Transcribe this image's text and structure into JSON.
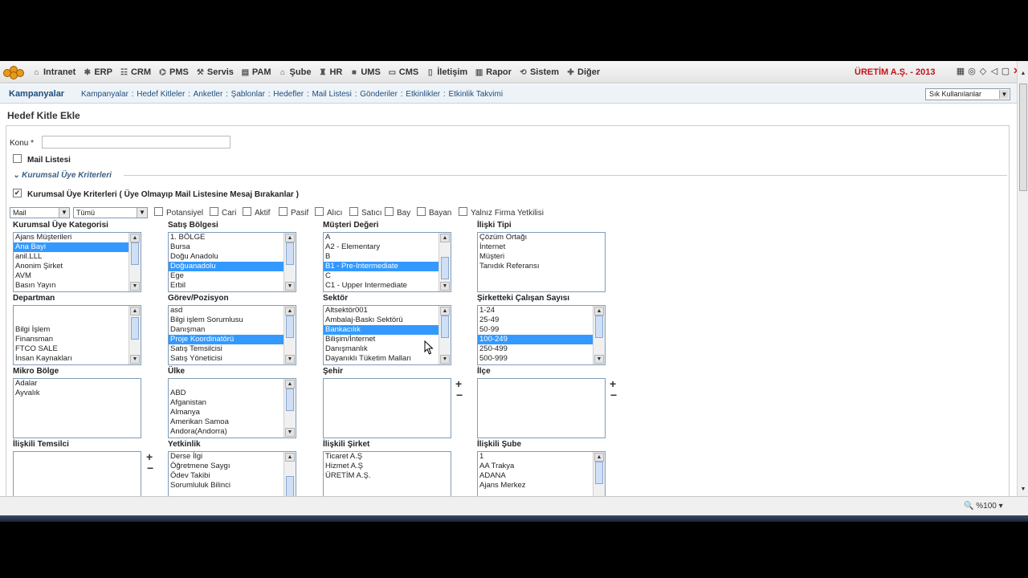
{
  "topbar": {
    "menu": [
      {
        "label": "Intranet",
        "icon": "folder-icon"
      },
      {
        "label": "ERP",
        "icon": "gear-icon"
      },
      {
        "label": "CRM",
        "icon": "crm-icon"
      },
      {
        "label": "PMS",
        "icon": "network-icon"
      },
      {
        "label": "Servis",
        "icon": "tools-icon"
      },
      {
        "label": "PAM",
        "icon": "printer-icon"
      },
      {
        "label": "Şube",
        "icon": "branch-icon"
      },
      {
        "label": "HR",
        "icon": "hr-icon"
      },
      {
        "label": "UMS",
        "icon": "ums-icon"
      },
      {
        "label": "CMS",
        "icon": "document-icon"
      },
      {
        "label": "İletişim",
        "icon": "contact-icon"
      },
      {
        "label": "Rapor",
        "icon": "chart-icon"
      },
      {
        "label": "Sistem",
        "icon": "refresh-icon"
      },
      {
        "label": "Diğer",
        "icon": "plus-icon"
      }
    ],
    "company": "ÜRETİM A.Ş. - 2013"
  },
  "subnav": {
    "title": "Kampanyalar",
    "links": [
      "Kampanyalar",
      "Hedef Kitleler",
      "Anketler",
      "Şablonlar",
      "Hedefler",
      "Mail Listesi",
      "Gönderiler",
      "Etkinlikler",
      "Etkinlik Takvimi"
    ],
    "separator": " : ",
    "favorites": "Sık Kullanılanlar"
  },
  "page": {
    "title": "Hedef Kitle Ekle",
    "konu_label": "Konu *",
    "mail_listesi": "Mail Listesi",
    "section": "Kurumsal Üye Kriterleri",
    "kriter_label": "Kurumsal Üye Kriterleri ( Üye Olmayıp Mail Listesine Mesaj Bırakanlar )"
  },
  "filters": {
    "select1": "Mail",
    "select2": "Tümü",
    "checks": [
      "Potansiyel",
      "Cari",
      "Aktif",
      "Pasif",
      "Alıcı",
      "Satıcı",
      "Bay",
      "Bayan",
      "Yalnız Firma Yetkilisi"
    ]
  },
  "fields": {
    "kurumsal_uye_kategorisi": {
      "label": "Kurumsal Üye Kategorisi",
      "options": [
        "Ajans Müşterileri",
        "Ana Bayi",
        "anil.LLL",
        "Anonim Şirket",
        "AVM",
        "Basın Yayın"
      ],
      "selected": 1
    },
    "satis_bolgesi": {
      "label": "Satış Bölgesi",
      "options": [
        "1. BÖLGE",
        "Bursa",
        "Doğu Anadolu",
        "Doğuanadolu",
        "Ege",
        "Erbil"
      ],
      "selected": 3
    },
    "musteri_degeri": {
      "label": "Müşteri Değeri",
      "options": [
        "A",
        "A2 - Elementary",
        "B",
        "B1 - Pre-Intermediate",
        "C",
        "C1 - Upper Intermediate"
      ],
      "selected": 3
    },
    "iliski_tipi": {
      "label": "İlişki Tipi",
      "options": [
        "Çözüm Ortağı",
        "İnternet",
        "Müşteri",
        "Tanıdık Referansı"
      ],
      "selected": -1
    },
    "departman": {
      "label": "Departman",
      "options": [
        "",
        "",
        "Bilgi İşlem",
        "Finansman",
        "FTCO SALE",
        "İnsan Kaynakları"
      ],
      "selected": -1
    },
    "gorev_pozisyon": {
      "label": "Görev/Pozisyon",
      "options": [
        "asd",
        "Bilgi işlem Sorumlusu",
        "Danışman",
        "Proje Koordinatörü",
        "Satış Temsilcisi",
        "Satış Yöneticisi"
      ],
      "selected": 3
    },
    "sektor": {
      "label": "Sektör",
      "options": [
        "Altsektör001",
        "Ambalaj-Baskı Sektörü",
        "Bankacılık",
        "Bilişim/İnternet",
        "Danışmanlık",
        "Dayanıklı Tüketim Malları"
      ],
      "selected": 2
    },
    "calisan_sayisi": {
      "label": "Şirketteki Çalışan Sayısı",
      "options": [
        "1-24",
        "25-49",
        "50-99",
        "100-249",
        "250-499",
        "500-999"
      ],
      "selected": 3
    },
    "mikro_bolge": {
      "label": "Mikro Bölge",
      "options": [
        "Adalar",
        "Ayvalık"
      ],
      "selected": -1
    },
    "ulke": {
      "label": "Ülke",
      "options": [
        "",
        "ABD",
        "Afganistan",
        "Almanya",
        "Amerikan Samoa",
        "Andora(Andorra)"
      ],
      "selected": -1
    },
    "sehir": {
      "label": "Şehir",
      "options": [],
      "selected": -1
    },
    "ilce": {
      "label": "İlçe",
      "options": [],
      "selected": -1
    },
    "iliskili_temsilci": {
      "label": "İlişkili Temsilci",
      "options": [],
      "selected": -1
    },
    "yetkinlik": {
      "label": "Yetkinlik",
      "options": [
        "Derse İlgi",
        "Öğretmene Saygı",
        "Ödev Takibi",
        "Sorumluluk Bilinci"
      ],
      "selected": -1
    },
    "iliskili_sirket": {
      "label": "İlişkili Şirket",
      "options": [
        "Ticaret A.Ş",
        "Hizmet A.Ş",
        "ÜRETİM A.Ş."
      ],
      "selected": -1
    },
    "iliskili_sube": {
      "label": "İlişkili Şube",
      "options": [
        "1",
        "AA Trakya",
        "ADANA",
        "Ajans Merkez"
      ],
      "selected": -1
    }
  },
  "status": {
    "zoom": "%100"
  },
  "colors": {
    "accent": "#1f4e7c",
    "brand": "#c0141a",
    "selection": "#3399ff"
  }
}
